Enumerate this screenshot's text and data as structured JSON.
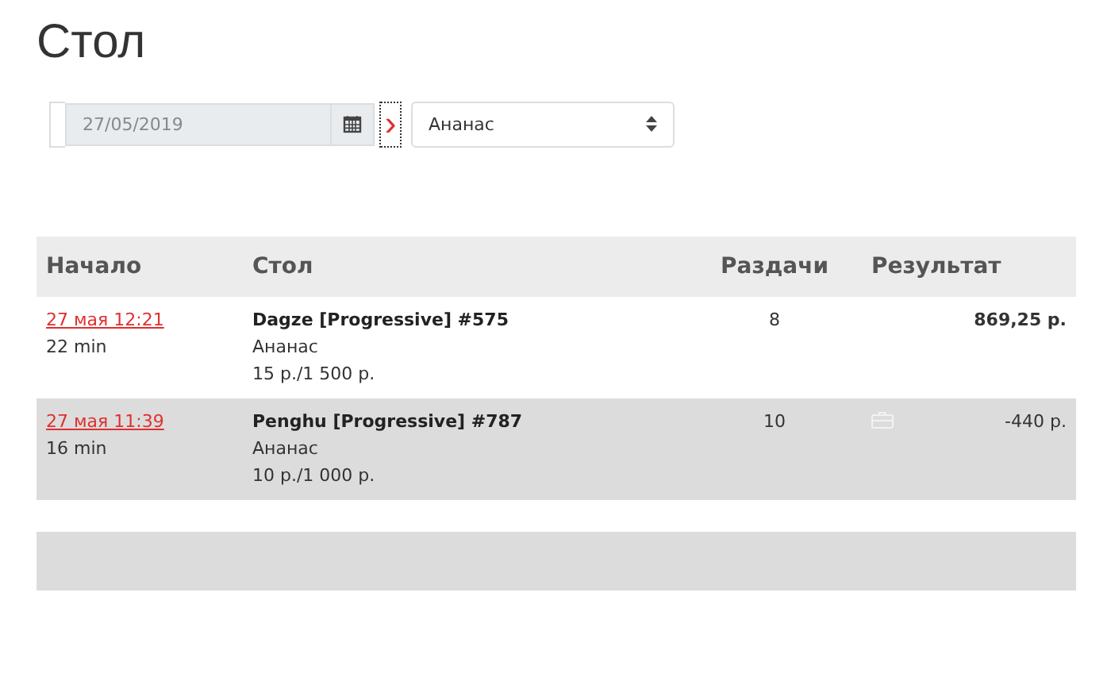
{
  "title": "Стол",
  "filter": {
    "date": "27/05/2019",
    "next_arrow": "›",
    "select": "Ананас"
  },
  "table": {
    "columns": [
      "Начало",
      "Стол",
      "Раздачи",
      "Результат"
    ],
    "rows": [
      {
        "start": "27 мая 12:21",
        "duration": "22 min",
        "name": "Dagze [Progressive] #575",
        "room": "Ананас",
        "stakes": "15 р./1 500 р.",
        "hands": "8",
        "result": "869,25 р.",
        "shaded": false,
        "bold_result": true,
        "icon": false
      },
      {
        "start": "27 мая 11:39",
        "duration": "16 min",
        "name": "Penghu [Progressive] #787",
        "room": "Ананас",
        "stakes": "10 р./1 000 р.",
        "hands": "10",
        "result": "-440 р.",
        "shaded": true,
        "bold_result": false,
        "icon": true
      }
    ]
  }
}
